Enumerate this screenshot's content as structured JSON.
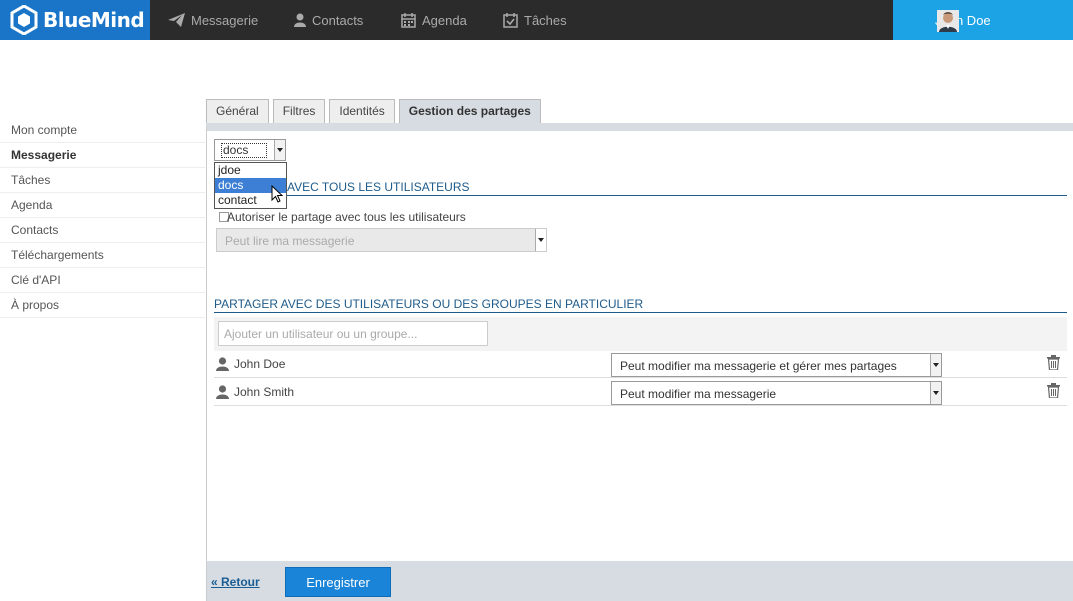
{
  "brand": {
    "name": "BlueMind"
  },
  "appnav": [
    {
      "label": "Messagerie",
      "icon": "paper-plane-icon"
    },
    {
      "label": "Contacts",
      "icon": "person-icon"
    },
    {
      "label": "Agenda",
      "icon": "calendar-icon"
    },
    {
      "label": "Tâches",
      "icon": "task-check-icon"
    }
  ],
  "user": {
    "name": "John Doe"
  },
  "sidebar": {
    "items": [
      {
        "label": "Mon compte"
      },
      {
        "label": "Messagerie",
        "active": true
      },
      {
        "label": "Tâches"
      },
      {
        "label": "Agenda"
      },
      {
        "label": "Contacts"
      },
      {
        "label": "Téléchargements"
      },
      {
        "label": "Clé d'API"
      },
      {
        "label": "À propos"
      }
    ]
  },
  "tabs": [
    {
      "label": "Général"
    },
    {
      "label": "Filtres"
    },
    {
      "label": "Identités"
    },
    {
      "label": "Gestion des partages",
      "active": true
    }
  ],
  "mailbox_select": {
    "value": "docs",
    "options": [
      "jdoe",
      "docs",
      "contact"
    ],
    "highlighted": "docs"
  },
  "share_all": {
    "title": "AVEC TOUS LES UTILISATEURS",
    "checkbox_label": "Autoriser le partage avec tous les utilisateurs",
    "checkbox_visible_label": "e partage avec tous les utilisateurs",
    "checkbox_prefix": "Autoriser l",
    "permission_value": "Peut lire ma messagerie"
  },
  "share_specific": {
    "title": "PARTAGER AVEC DES UTILISATEURS OU DES GROUPES EN PARTICULIER",
    "search_placeholder": "Ajouter un utilisateur ou un groupe...",
    "entries": [
      {
        "name": "John Doe",
        "permission": "Peut modifier ma messagerie et gérer mes partages"
      },
      {
        "name": "John Smith",
        "permission": "Peut modifier ma messagerie"
      }
    ]
  },
  "footer": {
    "back_label": "« Retour",
    "save_label": "Enregistrer"
  },
  "colors": {
    "brand_blue": "#1a74c7",
    "user_blue": "#1ba3e6",
    "topbar": "#2b2b2b",
    "section_blue": "#1e5b8a",
    "save_button": "#1a84d8"
  }
}
